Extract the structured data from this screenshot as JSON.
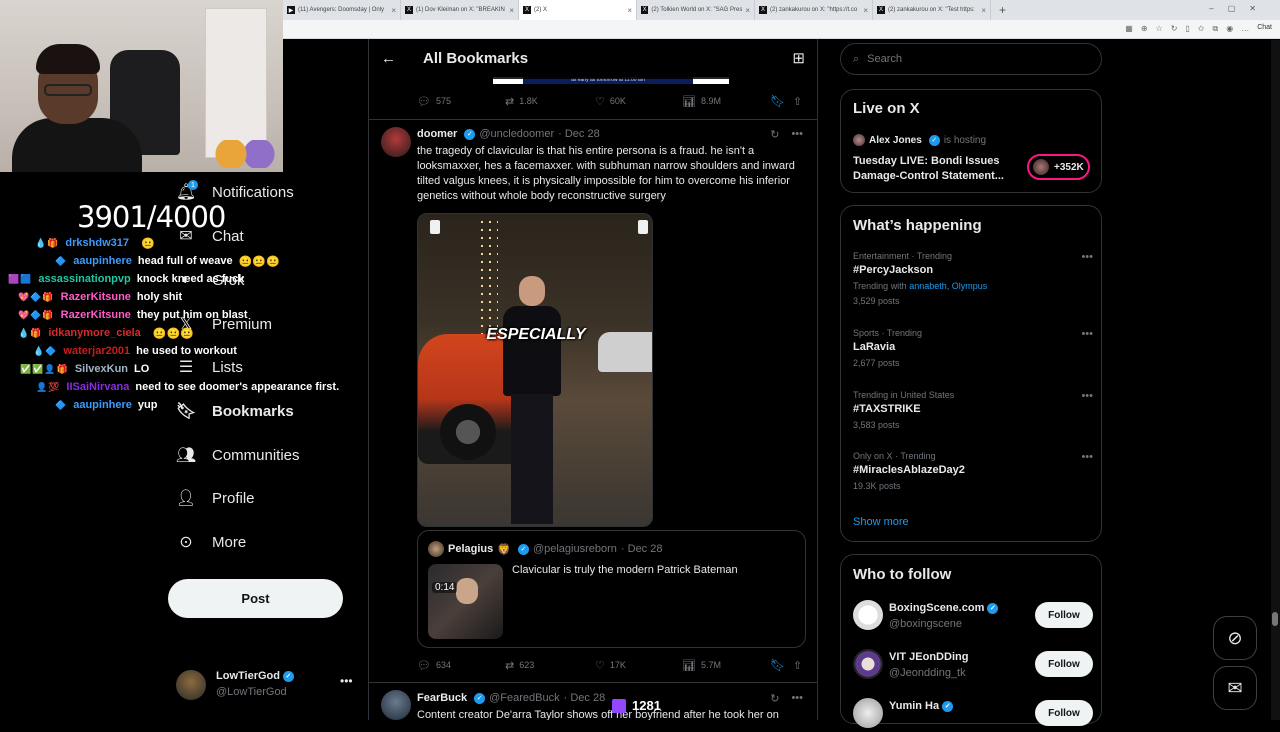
{
  "browser": {
    "tabs": [
      {
        "label": "(11) Avengers: Doomsday | Only"
      },
      {
        "label": "(1) Dov Kleiman on X: \"BREAKIN"
      },
      {
        "label": "(2) X"
      },
      {
        "label": "(2) Tolkien World on X: \"SAG Pres"
      },
      {
        "label": "(2) zankakurou on X: \"https://t.co"
      },
      {
        "label": "(2) zankakurou on X: \"Test https:"
      }
    ],
    "chat_label": "Chat"
  },
  "stream": {
    "sub_count": "3901/4000",
    "chat": [
      {
        "user": "drkshdw317",
        "user_color": "#3d9bff",
        "msg": ""
      },
      {
        "user": "aaupinhere",
        "user_color": "#3d9bff",
        "msg": "head full of weave"
      },
      {
        "user": "assassinationpvp",
        "user_color": "#1ec8a5",
        "msg": "knock kneed as fuck"
      },
      {
        "user": "RazerKitsune",
        "user_color": "#ff5cc8",
        "msg": "holy shit"
      },
      {
        "user": "RazerKitsune",
        "user_color": "#ff5cc8",
        "msg": "they put him on blast"
      },
      {
        "user": "idkanymore_ciela",
        "user_color": "#d92a2a",
        "msg": ""
      },
      {
        "user": "waterjar2001",
        "user_color": "#c81c1c",
        "msg": "he used to workout"
      },
      {
        "user": "SilvexKun",
        "user_color": "#9fb6c7",
        "msg": "LO"
      },
      {
        "user": "IISaiNirvana",
        "user_color": "#8a2be2",
        "msg": "need to see doomer's appearance first."
      },
      {
        "user": "aaupinhere",
        "user_color": "#3d9bff",
        "msg": "yup"
      }
    ],
    "viewer_count": "1281"
  },
  "nav": {
    "notifications": "Notifications",
    "notifications_badge": "1",
    "chat": "Chat",
    "grok": "Grok",
    "premium": "Premium",
    "lists": "Lists",
    "bookmarks": "Bookmarks",
    "communities": "Communities",
    "profile": "Profile",
    "more": "More",
    "post": "Post",
    "account_name": "LowTierGod",
    "account_handle": "@LowTierGod"
  },
  "main": {
    "title": "All Bookmarks",
    "prev_media_text": "as early as tomorrow at 11:00 am",
    "prev_actions": {
      "replies": "575",
      "reposts": "1.8K",
      "likes": "60K",
      "views": "8.9M"
    },
    "tweet1": {
      "name": "doomer",
      "handle": "@uncledoomer",
      "date": "· Dec 28",
      "text": "the tragedy of clavicular is that his entire persona is a fraud. he isn't a looksmaxxer, hes a facemaxxer. with subhuman narrow shoulders and inward tilted valgus knees, it is physically impossible for him to overcome his inferior genetics without whole body reconstructive surgery",
      "media_caption": "ESPECIALLY",
      "quote": {
        "name": "Pelagius",
        "handle": "@pelagiusreborn",
        "date": "· Dec 28",
        "text": "Clavicular is truly the modern Patrick Bateman",
        "duration": "0:14"
      },
      "actions": {
        "replies": "634",
        "reposts": "623",
        "likes": "17K",
        "views": "5.7M"
      }
    },
    "tweet2": {
      "name": "FearBuck",
      "handle": "@FearedBuck",
      "date": "· Dec 28",
      "text": "Content creator De'arra Taylor shows off her boyfriend after he took her on"
    }
  },
  "right": {
    "search_placeholder": "Search",
    "live": {
      "title": "Live on X",
      "host": "Alex Jones",
      "host_meta": "is hosting",
      "space_title": "Tuesday LIVE: Bondi Issues Damage-Control Statement...",
      "listeners": "+352K"
    },
    "happening": {
      "title": "What’s happening",
      "trends": [
        {
          "cat": "Entertainment · Trending",
          "name": "#PercyJackson",
          "extra_prefix": "Trending with",
          "links": "annabeth, Olympus",
          "count": "3,529 posts"
        },
        {
          "cat": "Sports · Trending",
          "name": "LaRavia",
          "count": "2,677 posts"
        },
        {
          "cat": "Trending in United States",
          "name": "#TAXSTRIKE",
          "count": "3,583 posts"
        },
        {
          "cat": "Only on X · Trending",
          "name": "#MiraclesAblazeDay2",
          "count": "19.3K posts"
        }
      ],
      "show_more": "Show more"
    },
    "who": {
      "title": "Who to follow",
      "follow_label": "Follow",
      "accounts": [
        {
          "name": "BoxingScene.com",
          "handle": "@boxingscene"
        },
        {
          "name": "VIT JEonDDing",
          "handle": "@Jeondding_tk"
        },
        {
          "name": "Yumin Ha",
          "handle": ""
        }
      ]
    }
  },
  "colors": {
    "accent": "#1d9bf0",
    "background": "#000000",
    "border": "#2f3336",
    "muted": "#71767b",
    "live_pink": "#f91880"
  }
}
